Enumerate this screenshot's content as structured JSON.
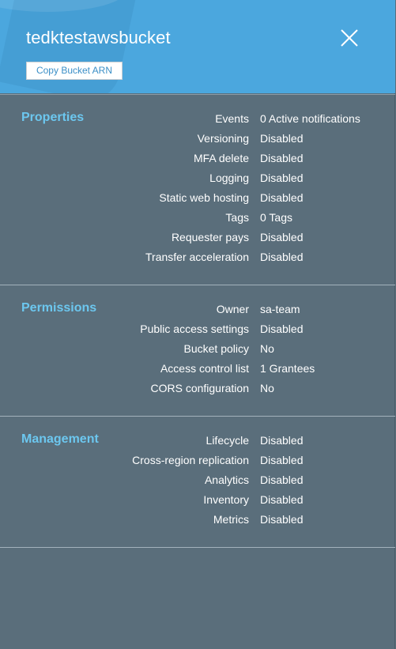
{
  "header": {
    "title": "tedktestawsbucket",
    "copy_arn_label": "Copy Bucket ARN",
    "close_icon": "close-icon"
  },
  "colors": {
    "header_bg": "#4ba7de",
    "panel_bg": "#5a6e7b",
    "section_title": "#6cc7ef",
    "text": "#ffffff"
  },
  "sections": {
    "properties": {
      "title": "Properties",
      "rows": [
        {
          "label": "Events",
          "value": "0 Active notifications"
        },
        {
          "label": "Versioning",
          "value": "Disabled"
        },
        {
          "label": "MFA delete",
          "value": "Disabled"
        },
        {
          "label": "Logging",
          "value": "Disabled"
        },
        {
          "label": "Static web hosting",
          "value": "Disabled"
        },
        {
          "label": "Tags",
          "value": "0 Tags"
        },
        {
          "label": "Requester pays",
          "value": "Disabled"
        },
        {
          "label": "Transfer acceleration",
          "value": "Disabled"
        }
      ]
    },
    "permissions": {
      "title": "Permissions",
      "rows": [
        {
          "label": "Owner",
          "value": "sa-team"
        },
        {
          "label": "Public access settings",
          "value": "Disabled"
        },
        {
          "label": "Bucket policy",
          "value": "No"
        },
        {
          "label": "Access control list",
          "value": "1 Grantees"
        },
        {
          "label": "CORS configuration",
          "value": "No"
        }
      ]
    },
    "management": {
      "title": "Management",
      "rows": [
        {
          "label": "Lifecycle",
          "value": "Disabled"
        },
        {
          "label": "Cross-region replication",
          "value": "Disabled"
        },
        {
          "label": "Analytics",
          "value": "Disabled"
        },
        {
          "label": "Inventory",
          "value": "Disabled"
        },
        {
          "label": "Metrics",
          "value": "Disabled"
        }
      ]
    }
  }
}
